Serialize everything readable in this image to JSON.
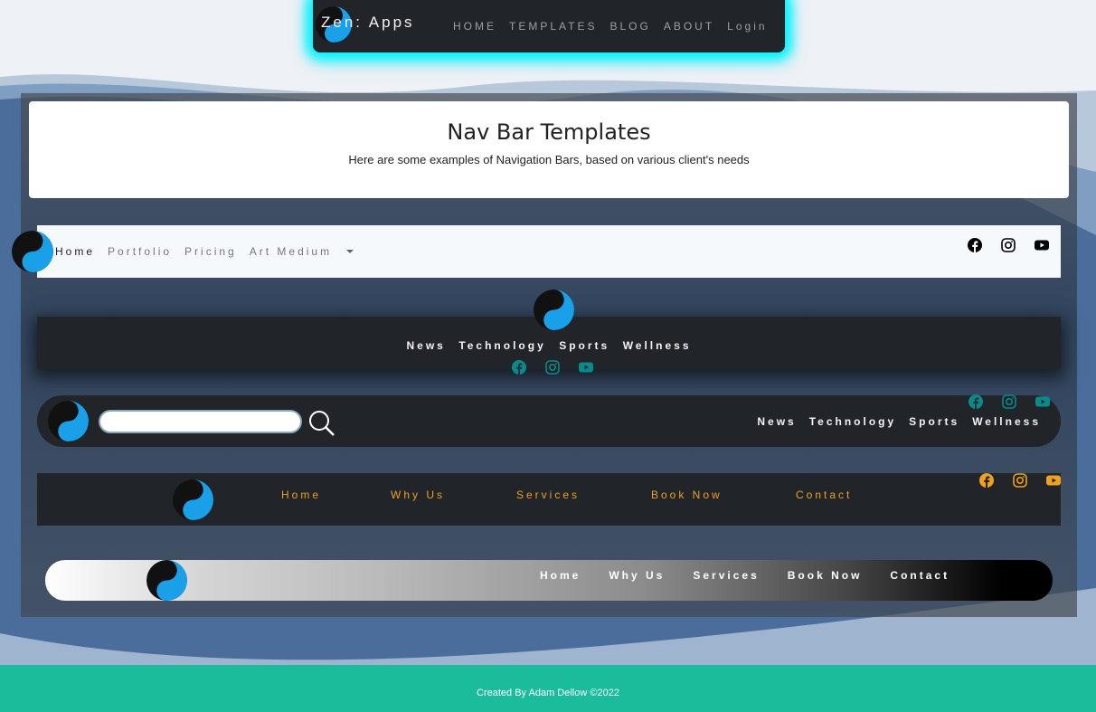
{
  "topnav": {
    "brand": "Zen: Apps",
    "links": [
      "HOME",
      "TEMPLATES",
      "BLOG",
      "ABOUT",
      "Login"
    ]
  },
  "header": {
    "title": "Nav Bar Templates",
    "subtitle": "Here are some examples of Navigation Bars, based on various client's needs"
  },
  "nav1": {
    "links": [
      "Home",
      "Portfolio",
      "Pricing",
      "Art Medium"
    ],
    "socials": [
      "facebook-icon",
      "instagram-icon",
      "youtube-icon"
    ],
    "social_color": "#000000"
  },
  "nav2": {
    "links": [
      "News",
      "Technology",
      "Sports",
      "Wellness"
    ],
    "social_color": "#0b8a8a"
  },
  "nav3": {
    "search_placeholder": "",
    "links": [
      "News",
      "Technology",
      "Sports",
      "Wellness"
    ],
    "social_color": "#0b8a8a"
  },
  "nav4": {
    "links": [
      "Home",
      "Why Us",
      "Services",
      "Book Now",
      "Contact"
    ],
    "link_color": "#f0a020"
  },
  "nav5": {
    "links": [
      "Home",
      "Why Us",
      "Services",
      "Book Now",
      "Contact"
    ]
  },
  "footer": {
    "text": "Created By Adam Dellow ©2022"
  },
  "colors": {
    "accent_glow": "#00f2ff",
    "dark_bar": "#212529",
    "footer": "#1abc9c",
    "logo_blue": "#1aa0e8"
  }
}
